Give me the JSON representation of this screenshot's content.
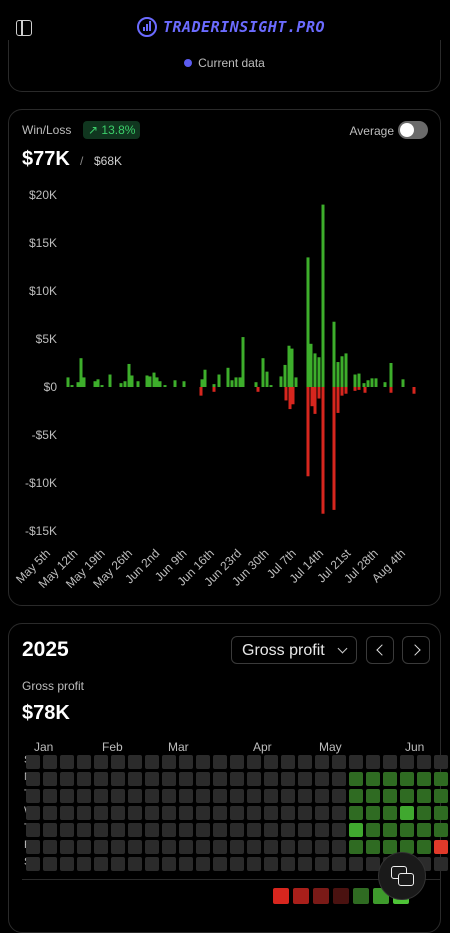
{
  "header": {
    "brand": "TRADERINSIGHT.PRO"
  },
  "top_card": {
    "legend_label": "Current data",
    "legend_color": "#5b5bf0"
  },
  "winloss": {
    "title": "Win/Loss",
    "change_badge": "13.8%",
    "average_label": "Average",
    "average_enabled": false,
    "value": "$77K",
    "separator": "/",
    "comparison": "$68K",
    "colors": {
      "positive": "#3dae2b",
      "negative": "#d7261e"
    },
    "chart_data": {
      "type": "bar",
      "y_ticks": [
        "$20K",
        "$15K",
        "$10K",
        "$5K",
        "$0",
        "-$5K",
        "-$10K",
        "-$15K"
      ],
      "ylim": [
        -15000,
        20000
      ],
      "x_ticks": [
        "May 5th",
        "May 12th",
        "May 19th",
        "May 26th",
        "Jun 2nd",
        "Jun 9th",
        "Jun 16th",
        "Jun 23rd",
        "Jun 30th",
        "Jul 7th",
        "Jul 14th",
        "Jul 21st",
        "Jul 28th",
        "Aug 4th"
      ],
      "series": [
        {
          "values": [
            {
              "x": 68,
              "v": 1000
            },
            {
              "x": 72,
              "v": 200
            },
            {
              "x": 78,
              "v": 500
            },
            {
              "x": 81,
              "v": 3000
            },
            {
              "x": 84,
              "v": 1000
            },
            {
              "x": 95,
              "v": 600
            },
            {
              "x": 98,
              "v": 800
            },
            {
              "x": 102,
              "v": 200
            },
            {
              "x": 110,
              "v": 1300
            },
            {
              "x": 121,
              "v": 400
            },
            {
              "x": 125,
              "v": 600
            },
            {
              "x": 129,
              "v": 2400
            },
            {
              "x": 132,
              "v": 1200
            },
            {
              "x": 138,
              "v": 600
            },
            {
              "x": 147,
              "v": 1200
            },
            {
              "x": 150,
              "v": 1100
            },
            {
              "x": 154,
              "v": 1500
            },
            {
              "x": 157,
              "v": 1000
            },
            {
              "x": 160,
              "v": 600
            },
            {
              "x": 165,
              "v": 200
            },
            {
              "x": 175,
              "v": 700
            },
            {
              "x": 184,
              "v": 600
            },
            {
              "x": 202,
              "v": 800
            },
            {
              "x": 205,
              "v": 1800
            },
            {
              "x": 214,
              "v": 300
            },
            {
              "x": 219,
              "v": 1300
            },
            {
              "x": 228,
              "v": 2000
            },
            {
              "x": 232,
              "v": 700
            },
            {
              "x": 236,
              "v": 1000
            },
            {
              "x": 240,
              "v": 1000
            },
            {
              "x": 243,
              "v": 5200
            },
            {
              "x": 256,
              "v": 500
            },
            {
              "x": 263,
              "v": 3000
            },
            {
              "x": 267,
              "v": 1600
            },
            {
              "x": 271,
              "v": 200
            },
            {
              "x": 281,
              "v": 1100
            },
            {
              "x": 285,
              "v": 2300
            },
            {
              "x": 289,
              "v": 4300
            },
            {
              "x": 292,
              "v": 4000
            },
            {
              "x": 296,
              "v": 1000
            },
            {
              "x": 308,
              "v": 13500
            },
            {
              "x": 311,
              "v": 4500
            },
            {
              "x": 315,
              "v": 3500
            },
            {
              "x": 319,
              "v": 3100
            },
            {
              "x": 323,
              "v": 19000
            },
            {
              "x": 334,
              "v": 6800
            },
            {
              "x": 338,
              "v": 2600
            },
            {
              "x": 342,
              "v": 3200
            },
            {
              "x": 346,
              "v": 3500
            },
            {
              "x": 355,
              "v": 1300
            },
            {
              "x": 359,
              "v": 1400
            },
            {
              "x": 364,
              "v": 400
            },
            {
              "x": 368,
              "v": 700
            },
            {
              "x": 372,
              "v": 900
            },
            {
              "x": 376,
              "v": 900
            },
            {
              "x": 385,
              "v": 500
            },
            {
              "x": 391,
              "v": 2500
            },
            {
              "x": 403,
              "v": 800
            }
          ]
        },
        {
          "values": [
            {
              "x": 201,
              "v": -900
            },
            {
              "x": 214,
              "v": -500
            },
            {
              "x": 258,
              "v": -500
            },
            {
              "x": 286,
              "v": -1400
            },
            {
              "x": 290,
              "v": -2300
            },
            {
              "x": 293,
              "v": -1800
            },
            {
              "x": 308,
              "v": -9300
            },
            {
              "x": 312,
              "v": -2000
            },
            {
              "x": 315,
              "v": -2800
            },
            {
              "x": 319,
              "v": -1200
            },
            {
              "x": 323,
              "v": -13200
            },
            {
              "x": 334,
              "v": -12800
            },
            {
              "x": 338,
              "v": -2700
            },
            {
              "x": 342,
              "v": -900
            },
            {
              "x": 346,
              "v": -700
            },
            {
              "x": 355,
              "v": -400
            },
            {
              "x": 359,
              "v": -300
            },
            {
              "x": 365,
              "v": -600
            },
            {
              "x": 391,
              "v": -600
            },
            {
              "x": 414,
              "v": -700
            }
          ]
        }
      ]
    }
  },
  "calendar": {
    "year": "2025",
    "metric_select": "Gross profit",
    "metric_label": "Gross profit",
    "value": "$78K",
    "months": [
      "Jan",
      "Feb",
      "Mar",
      "Apr",
      "May",
      "Jun"
    ],
    "weekdays": [
      "S",
      "M",
      "T",
      "W",
      "T",
      "F",
      "S"
    ],
    "empty_color": "#2b2b2b",
    "active_cells": [
      {
        "col": 19,
        "row": 1,
        "c": "#2f6b22"
      },
      {
        "col": 20,
        "row": 1,
        "c": "#2f6b22"
      },
      {
        "col": 21,
        "row": 1,
        "c": "#2f6b22"
      },
      {
        "col": 22,
        "row": 1,
        "c": "#2f6b22"
      },
      {
        "col": 23,
        "row": 1,
        "c": "#2f6b22"
      },
      {
        "col": 24,
        "row": 1,
        "c": "#2f6b22"
      },
      {
        "col": 25,
        "row": 1,
        "c": "#2b2b2b"
      },
      {
        "col": 19,
        "row": 2,
        "c": "#2f6b22"
      },
      {
        "col": 20,
        "row": 2,
        "c": "#2f6b22"
      },
      {
        "col": 21,
        "row": 2,
        "c": "#2f6b22"
      },
      {
        "col": 22,
        "row": 2,
        "c": "#2f6b22"
      },
      {
        "col": 23,
        "row": 2,
        "c": "#2f6b22"
      },
      {
        "col": 24,
        "row": 2,
        "c": "#2f6b22"
      },
      {
        "col": 25,
        "row": 2,
        "c": "#40a82f"
      },
      {
        "col": 19,
        "row": 3,
        "c": "#2f6b22"
      },
      {
        "col": 20,
        "row": 3,
        "c": "#2f6b22"
      },
      {
        "col": 21,
        "row": 3,
        "c": "#2f6b22"
      },
      {
        "col": 22,
        "row": 3,
        "c": "#40a82f"
      },
      {
        "col": 23,
        "row": 3,
        "c": "#2f6b22"
      },
      {
        "col": 24,
        "row": 3,
        "c": "#2f6b22"
      },
      {
        "col": 25,
        "row": 3,
        "c": "#2f6b22"
      },
      {
        "col": 19,
        "row": 4,
        "c": "#40a82f"
      },
      {
        "col": 20,
        "row": 4,
        "c": "#2f6b22"
      },
      {
        "col": 21,
        "row": 4,
        "c": "#2f6b22"
      },
      {
        "col": 22,
        "row": 4,
        "c": "#2f6b22"
      },
      {
        "col": 23,
        "row": 4,
        "c": "#2f6b22"
      },
      {
        "col": 24,
        "row": 4,
        "c": "#2f6b22"
      },
      {
        "col": 25,
        "row": 4,
        "c": "#e03a2a"
      },
      {
        "col": 19,
        "row": 5,
        "c": "#2f6b22"
      },
      {
        "col": 20,
        "row": 5,
        "c": "#2f6b22"
      },
      {
        "col": 21,
        "row": 5,
        "c": "#2f6b22"
      },
      {
        "col": 22,
        "row": 5,
        "c": "#2f6b22"
      },
      {
        "col": 23,
        "row": 5,
        "c": "#2f6b22"
      },
      {
        "col": 24,
        "row": 5,
        "c": "#e03a2a"
      },
      {
        "col": 25,
        "row": 5,
        "c": "#2f6b22"
      }
    ],
    "scale_colors": [
      "#d7261e",
      "#a81f1a",
      "#7a1a17",
      "#4a1210",
      "#2f6b22",
      "#3e9a2c",
      "#4ec337"
    ]
  },
  "chat_button": {
    "icon": "chat-icon"
  }
}
